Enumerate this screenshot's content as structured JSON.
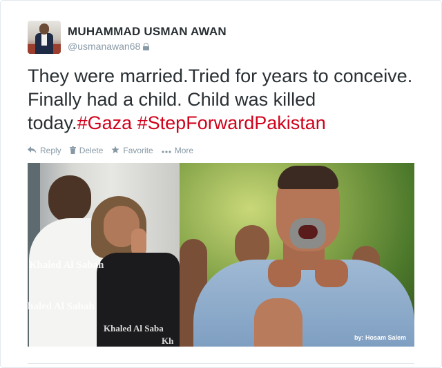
{
  "user": {
    "display_name": "MUHAMMAD USMAN AWAN",
    "handle": "@usmanawan68",
    "protected_icon": "lock-icon"
  },
  "tweet": {
    "text_plain": "They were married.Tried for years to conceive. Finally had a child. Child was killed today.",
    "hashtags": [
      "#Gaza",
      "#StepForwardPakistan"
    ],
    "hashtag_color": "#d0021b"
  },
  "actions": [
    {
      "icon": "reply-icon",
      "label": "Reply"
    },
    {
      "icon": "trash-icon",
      "label": "Delete"
    },
    {
      "icon": "star-icon",
      "label": "Favorite"
    },
    {
      "icon": "more-dots-icon",
      "label": "More"
    }
  ],
  "media": {
    "watermarks": [
      "Khaled Al Sabah",
      "haled Al Sabah",
      "Khaled Al Saba",
      "Kh"
    ],
    "credit": "by: Hosam Salem"
  },
  "colors": {
    "text": "#292f33",
    "muted": "#8899a6",
    "border": "#e1e8ed"
  }
}
